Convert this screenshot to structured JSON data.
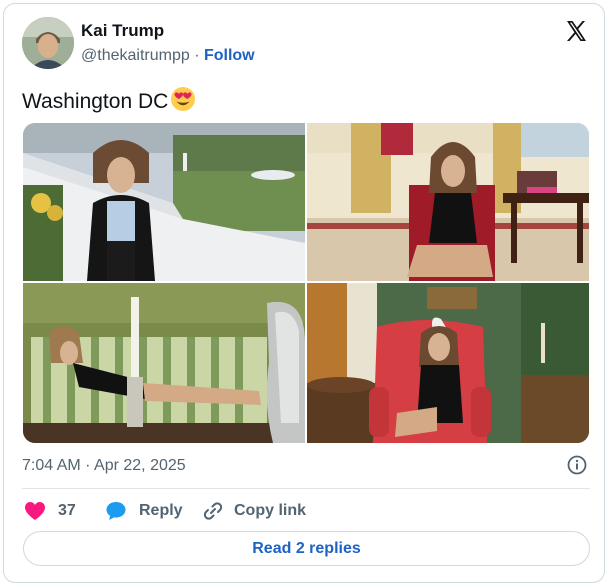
{
  "author": {
    "name": "Kai Trump",
    "handle": "@thekaitrumpp",
    "separator": "·",
    "follow_label": "Follow"
  },
  "tweet": {
    "text": "Washington DC",
    "emoji": "heart-eyes-emoji",
    "images": [
      {
        "icon": "photo-white-house-balcony"
      },
      {
        "icon": "photo-chair-room-black-dress"
      },
      {
        "icon": "photo-striped-chaise-lounge"
      },
      {
        "icon": "photo-red-armchair-green-room"
      }
    ]
  },
  "meta": {
    "timestamp": "7:04 AM · Apr 22, 2025"
  },
  "actions": {
    "like_count": "37",
    "reply_label": "Reply",
    "copy_label": "Copy link"
  },
  "read_replies_label": "Read 2 replies",
  "colors": {
    "accent": "#1d62c4",
    "like": "#f91880",
    "reply_bubble": "#1d9bf0",
    "muted": "#536471"
  }
}
